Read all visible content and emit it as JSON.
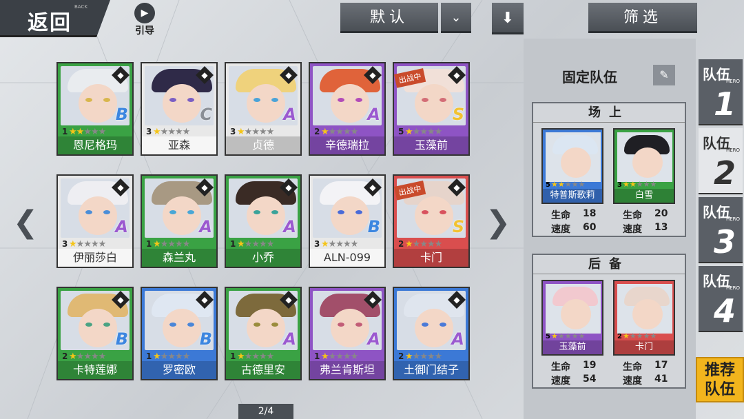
{
  "topbar": {
    "back_label": "返回",
    "back_sub": "BACK",
    "guide_label": "引导",
    "sort_label": "默认",
    "filter_label": "筛选"
  },
  "cards": [
    {
      "name": "恩尼格玛",
      "level": "1",
      "stars": 2,
      "grade": "B",
      "color": "green"
    },
    {
      "name": "亚森",
      "level": "3",
      "stars": 1,
      "grade": "C",
      "color": "white"
    },
    {
      "name": "贞德",
      "level": "3",
      "stars": 1,
      "grade": "A",
      "color": "yellow"
    },
    {
      "name": "辛德瑞拉",
      "level": "2",
      "stars": 1,
      "grade": "A",
      "color": "purple"
    },
    {
      "name": "玉藻前",
      "level": "5",
      "stars": 1,
      "grade": "S",
      "color": "purple",
      "tag": "出战中"
    },
    {
      "name": "伊丽莎白",
      "level": "3",
      "stars": 1,
      "grade": "A",
      "color": "white"
    },
    {
      "name": "森兰丸",
      "level": "1",
      "stars": 1,
      "grade": "A",
      "color": "green"
    },
    {
      "name": "小乔",
      "level": "1",
      "stars": 1,
      "grade": "A",
      "color": "green"
    },
    {
      "name": "ALN-099",
      "level": "3",
      "stars": 1,
      "grade": "B",
      "color": "white"
    },
    {
      "name": "卡门",
      "level": "2",
      "stars": 1,
      "grade": "S",
      "color": "red",
      "tag": "出战中"
    },
    {
      "name": "卡特莲娜",
      "level": "2",
      "stars": 1,
      "grade": "B",
      "color": "green"
    },
    {
      "name": "罗密欧",
      "level": "1",
      "stars": 1,
      "grade": "B",
      "color": "blue"
    },
    {
      "name": "古德里安",
      "level": "1",
      "stars": 1,
      "grade": "A",
      "color": "green"
    },
    {
      "name": "弗兰肯斯坦",
      "level": "1",
      "stars": 1,
      "grade": "A",
      "color": "purple"
    },
    {
      "name": "土御门结子",
      "level": "2",
      "stars": 1,
      "grade": "A",
      "color": "blue"
    }
  ],
  "pager": "2/4",
  "panel": {
    "title": "固定队伍",
    "onfield_label": "场上",
    "reserve_label": "后备",
    "onfield": [
      {
        "name": "特普斯歌莉",
        "level": "5",
        "stars": 2,
        "hp_label": "生命",
        "hp": "18",
        "spd_label": "速度",
        "spd": "60"
      },
      {
        "name": "白雪",
        "level": "3",
        "stars": 2,
        "hp_label": "生命",
        "hp": "20",
        "spd_label": "速度",
        "spd": "13"
      }
    ],
    "reserve": [
      {
        "name": "玉藻前",
        "level": "5",
        "stars": 1,
        "hp_label": "生命",
        "hp": "19",
        "spd_label": "速度",
        "spd": "54"
      },
      {
        "name": "卡门",
        "level": "2",
        "stars": 1,
        "hp_label": "生命",
        "hp": "17",
        "spd_label": "速度",
        "spd": "41"
      }
    ]
  },
  "tabs": [
    {
      "label": "队伍",
      "num": "1",
      "hero": "HERO"
    },
    {
      "label": "队伍",
      "num": "2",
      "hero": "HERO"
    },
    {
      "label": "队伍",
      "num": "3",
      "hero": "HERO"
    },
    {
      "label": "队伍",
      "num": "4",
      "hero": "HERO"
    }
  ],
  "recommend": {
    "line1": "推荐",
    "line2": "队伍"
  }
}
